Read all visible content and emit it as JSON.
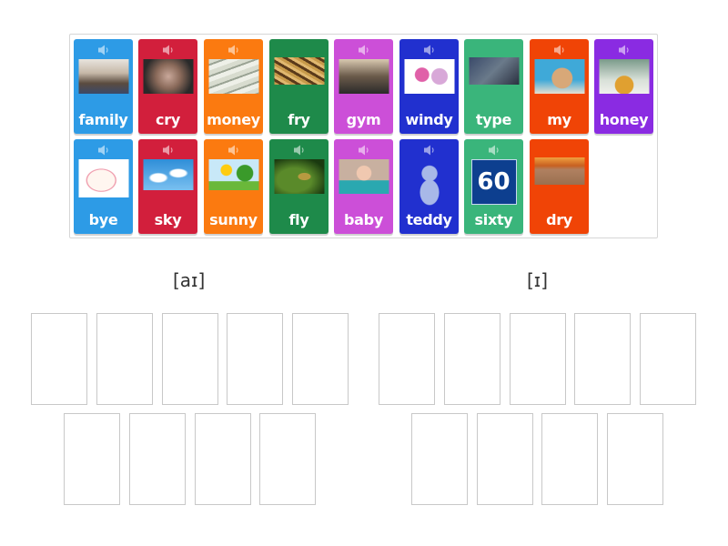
{
  "tray": {
    "cards": [
      {
        "word": "family",
        "color": "#2d9be6",
        "has_audio": true,
        "image": "family-photo"
      },
      {
        "word": "cry",
        "color": "#d21f3c",
        "has_audio": true,
        "image": "crying-person"
      },
      {
        "word": "money",
        "color": "#fb7a10",
        "has_audio": true,
        "image": "dollar-bills"
      },
      {
        "word": "fry",
        "color": "#1e8a4a",
        "has_audio": false,
        "image": "french-fries"
      },
      {
        "word": "gym",
        "color": "#cc4fd8",
        "has_audio": true,
        "image": "gym-people"
      },
      {
        "word": "windy",
        "color": "#2130cf",
        "has_audio": true,
        "image": "woman-in-wind"
      },
      {
        "word": "type",
        "color": "#3ab57b",
        "has_audio": false,
        "image": "typing-hands"
      },
      {
        "word": "my",
        "color": "#f04406",
        "has_audio": true,
        "image": "teddy-bears"
      },
      {
        "word": "honey",
        "color": "#8a2be2",
        "has_audio": true,
        "image": "honey-jar"
      },
      {
        "word": "bye",
        "color": "#2d9be6",
        "has_audio": true,
        "image": "waving-bear"
      },
      {
        "word": "sky",
        "color": "#d21f3c",
        "has_audio": true,
        "image": "blue-sky-clouds"
      },
      {
        "word": "sunny",
        "color": "#fb7a10",
        "has_audio": true,
        "image": "sun-and-tree"
      },
      {
        "word": "fly",
        "color": "#1e8a4a",
        "has_audio": true,
        "image": "insect-fly"
      },
      {
        "word": "baby",
        "color": "#cc4fd8",
        "has_audio": true,
        "image": "baby-face"
      },
      {
        "word": "teddy",
        "color": "#2130cf",
        "has_audio": true,
        "image": "blue-teddy-bear"
      },
      {
        "word": "sixty",
        "color": "#3ab57b",
        "has_audio": true,
        "image": "number-60-sign",
        "image_text": "60"
      },
      {
        "word": "dry",
        "color": "#f04406",
        "has_audio": false,
        "image": "cracked-desert"
      }
    ]
  },
  "groups": [
    {
      "label": "[aɪ]",
      "slots": 9
    },
    {
      "label": "[ɪ]",
      "slots": 9
    }
  ]
}
